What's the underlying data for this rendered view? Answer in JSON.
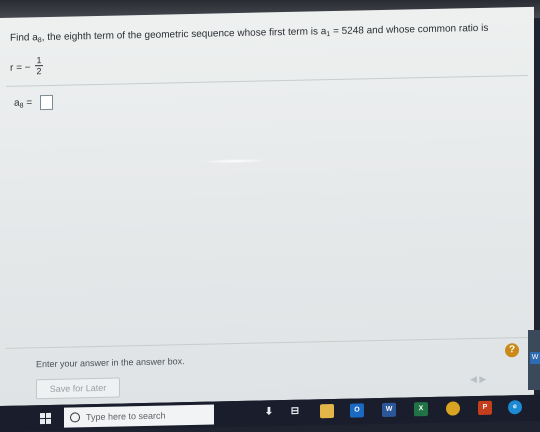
{
  "question": {
    "prefix": "Find a",
    "prefix_sub": "8",
    "middle": ", the eighth term of the geometric sequence whose first term is a",
    "first_sub": "1",
    "suffix": " = 5248 and whose common  ratio is",
    "ratio_label": "r = −",
    "ratio_num": "1",
    "ratio_den": "2"
  },
  "answer": {
    "label": "a",
    "label_sub": "8",
    "equals": " ="
  },
  "footer": {
    "hint": "Enter your answer in the answer box.",
    "help": "?",
    "save_label": "Save for Later",
    "nav_arrows": "◀  ▶"
  },
  "taskbar": {
    "search_placeholder": "Type here to search",
    "apps": [
      {
        "name": "outlook",
        "text": "O",
        "color": "#1b6ac2"
      },
      {
        "name": "word",
        "text": "W",
        "color": "#2b579a"
      },
      {
        "name": "excel",
        "text": "X",
        "color": "#217346"
      },
      {
        "name": "chrome",
        "text": "",
        "color": "#d9a421"
      },
      {
        "name": "powerpoint",
        "text": "P",
        "color": "#c43e1c"
      },
      {
        "name": "edge",
        "text": "e",
        "color": "#1b8ad3"
      }
    ]
  },
  "side": {
    "w_label": "W"
  }
}
